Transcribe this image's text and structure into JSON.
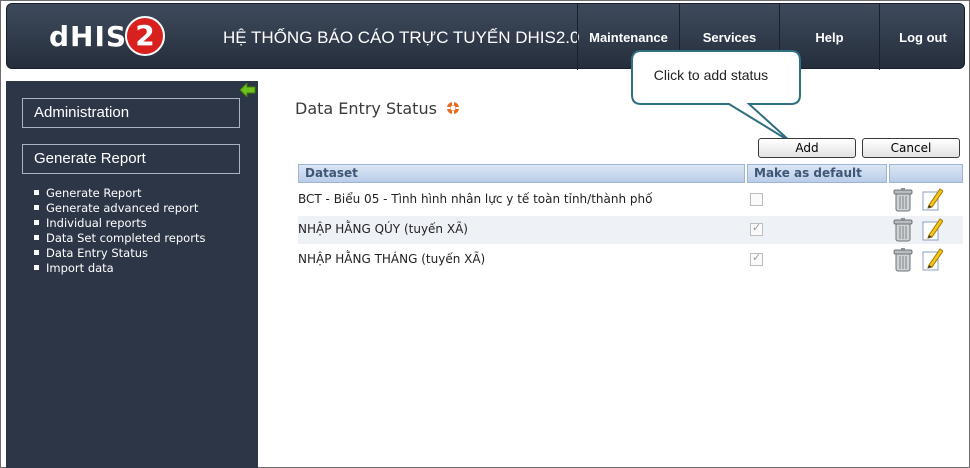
{
  "header": {
    "logo_text": "dHIS",
    "logo_number": "2",
    "title": "HỆ THỐNG BÁO CÁO TRỰC TUYẾN DHIS2.0",
    "nav": [
      "Maintenance",
      "Services",
      "Help",
      "Log out"
    ]
  },
  "sidebar": {
    "sections": [
      "Administration",
      "Generate Report"
    ],
    "links": [
      "Generate Report",
      "Generate advanced report",
      "Individual reports",
      "Data Set completed reports",
      "Data Entry Status",
      "Import data"
    ]
  },
  "main": {
    "title": "Data Entry Status",
    "callout": "Click to add status",
    "buttons": {
      "add": "Add",
      "cancel": "Cancel"
    },
    "table": {
      "headers": [
        "Dataset",
        "Make as default",
        ""
      ],
      "rows": [
        {
          "name": "BCT - Biểu 05 - Tình hình nhân lực y tế toàn tỉnh/thành phố",
          "default_checked": false
        },
        {
          "name": "NHẬP HẰNG QÚY (tuyến XÃ)",
          "default_checked": true
        },
        {
          "name": "NHẬP HẰNG THÁNG (tuyến XÃ)",
          "default_checked": true
        }
      ]
    }
  },
  "colors": {
    "header_bg": "#2d3644",
    "sidebar_bg": "#2c3646",
    "logo_red": "#d8211f",
    "table_header_bg": "#c6d7ee",
    "callout_border": "#2f6f80"
  }
}
